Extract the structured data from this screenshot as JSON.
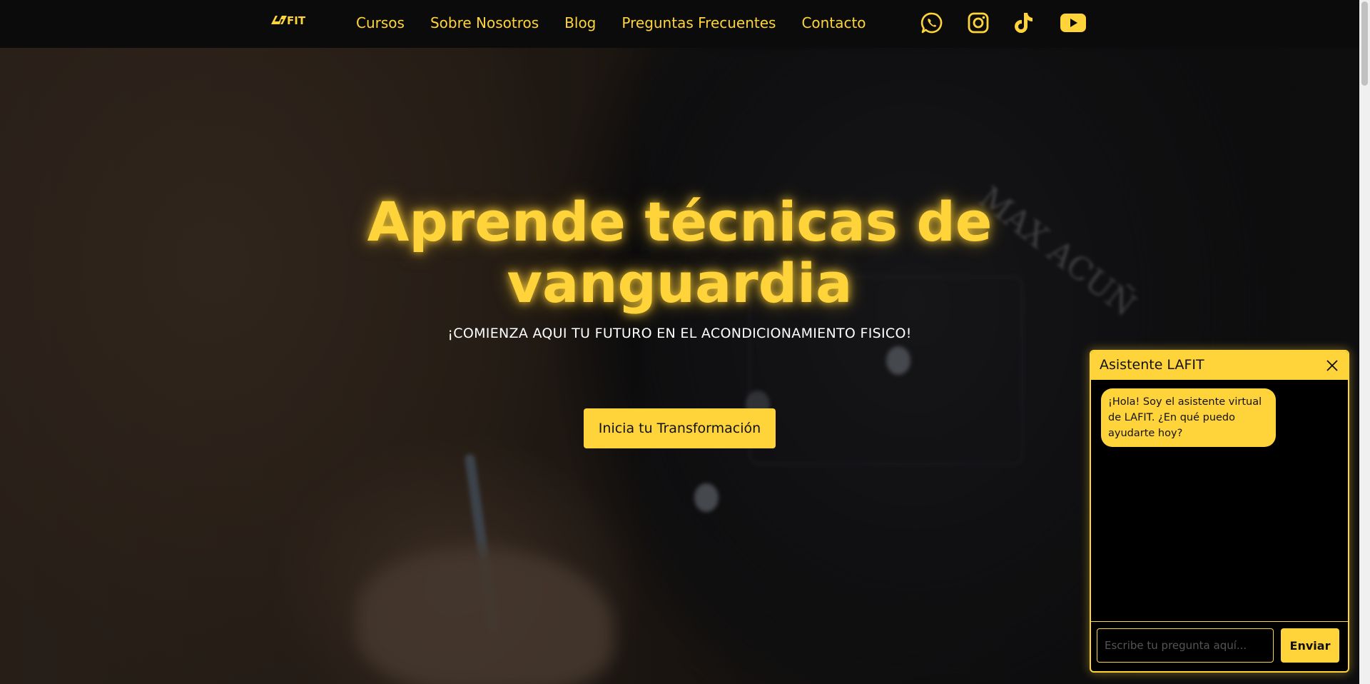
{
  "colors": {
    "accent": "#ffd43b",
    "navbar_bg": "#0b0b0b",
    "chat_bg": "#000000"
  },
  "navbar": {
    "logo_text": "LAFIT",
    "links": [
      {
        "label": "Cursos"
      },
      {
        "label": "Sobre Nosotros"
      },
      {
        "label": "Blog"
      },
      {
        "label": "Preguntas Frecuentes"
      },
      {
        "label": "Contacto"
      }
    ],
    "social_icons": [
      "whatsapp-icon",
      "instagram-icon",
      "tiktok-icon",
      "youtube-icon"
    ]
  },
  "hero": {
    "title": "Aprende técnicas de vanguardia",
    "subtitle": "¡COMIENZA AQUI TU FUTURO EN EL ACONDICIONAMIENTO FISICO!",
    "cta_label": "Inicia tu Transformación",
    "shirt_text": "MAX ACUÑ"
  },
  "chat": {
    "title": "Asistente LAFIT",
    "close_icon": "close-icon",
    "messages": [
      {
        "from": "bot",
        "text": "¡Hola! Soy el asistente virtual de LAFIT. ¿En qué puedo ayudarte hoy?"
      }
    ],
    "input_placeholder": "Escribe tu pregunta aquí...",
    "input_value": "",
    "send_label": "Enviar"
  }
}
